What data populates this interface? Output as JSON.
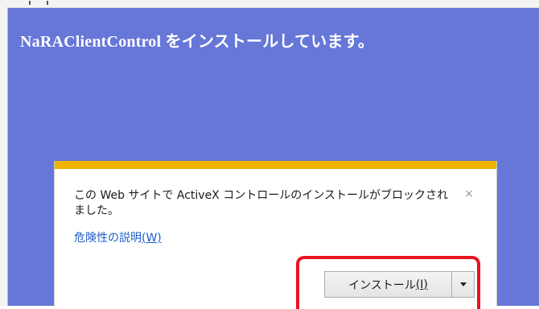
{
  "page": {
    "title_prefix": "NaRAClientControl",
    "title_suffix": "をインストールしています。"
  },
  "notification": {
    "message": "この Web サイトで ActiveX コントロールのインストールがブロックされました。",
    "link_text": "危険性の説明",
    "link_accel": "(W)",
    "close_glyph": "×",
    "close_icon": "close-icon"
  },
  "install_button": {
    "label": "インストール",
    "accel": "(I)",
    "dropdown_icon": "chevron-down-icon"
  },
  "colors": {
    "page_background": "#6677d8",
    "notification_accent": "#f0b400",
    "link": "#1e5dc9",
    "highlight": "#e8141e"
  }
}
